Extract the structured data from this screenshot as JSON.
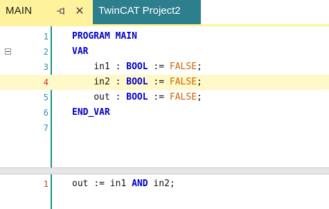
{
  "tabs": {
    "active": {
      "title": "MAIN",
      "pin_glyph": "⊣",
      "close_glyph": "✕"
    },
    "inactive": {
      "title": "TwinCAT Project2"
    }
  },
  "declaration": {
    "lines": [
      {
        "num": "1",
        "text": "PROGRAM MAIN"
      },
      {
        "num": "2",
        "text": "VAR"
      },
      {
        "num": "3",
        "var": "in1",
        "type": "BOOL",
        "init": "FALSE"
      },
      {
        "num": "4",
        "var": "in2",
        "type": "BOOL",
        "init": "FALSE"
      },
      {
        "num": "5",
        "var": "out",
        "type": "BOOL",
        "init": "FALSE"
      },
      {
        "num": "6",
        "text": "END_VAR"
      },
      {
        "num": "7",
        "text": ""
      }
    ]
  },
  "implementation": {
    "lines": [
      {
        "num": "1",
        "lhs": "out",
        "op": ":=",
        "a": "in1",
        "kw": "AND",
        "b": "in2"
      }
    ]
  },
  "colors": {
    "active_tab": "#fff29d",
    "inactive_tab": "#2d7f8e",
    "keyword": "#0000c8",
    "literal": "#c86400",
    "gutter": "#1c8d8a"
  }
}
